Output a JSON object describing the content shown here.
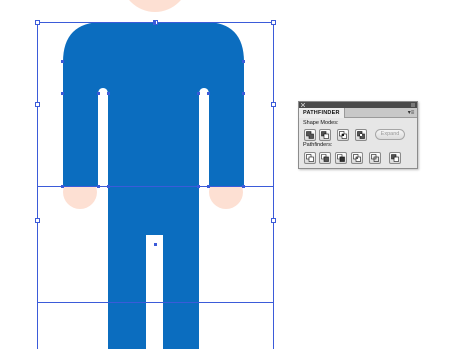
{
  "colors": {
    "body_fill": "#0b6dbf",
    "skin": "#fde0d3",
    "selection": "#3b5bd9",
    "canvas": "#ffffff",
    "panel_bg": "#e6e6e6"
  },
  "pathfinder": {
    "title": "PATHFINDER",
    "menu_icon": "panel-menu-icon",
    "shape_modes_label": "Shape Modes:",
    "shape_mode_buttons": [
      "unite-icon",
      "minus-front-icon",
      "intersect-icon",
      "exclude-icon"
    ],
    "expand_label": "Expand",
    "pathfinders_label": "Pathfinders:",
    "pathfinder_buttons": [
      "divide-icon",
      "trim-icon",
      "merge-icon",
      "crop-icon",
      "outline-icon",
      "minus-back-icon"
    ]
  }
}
